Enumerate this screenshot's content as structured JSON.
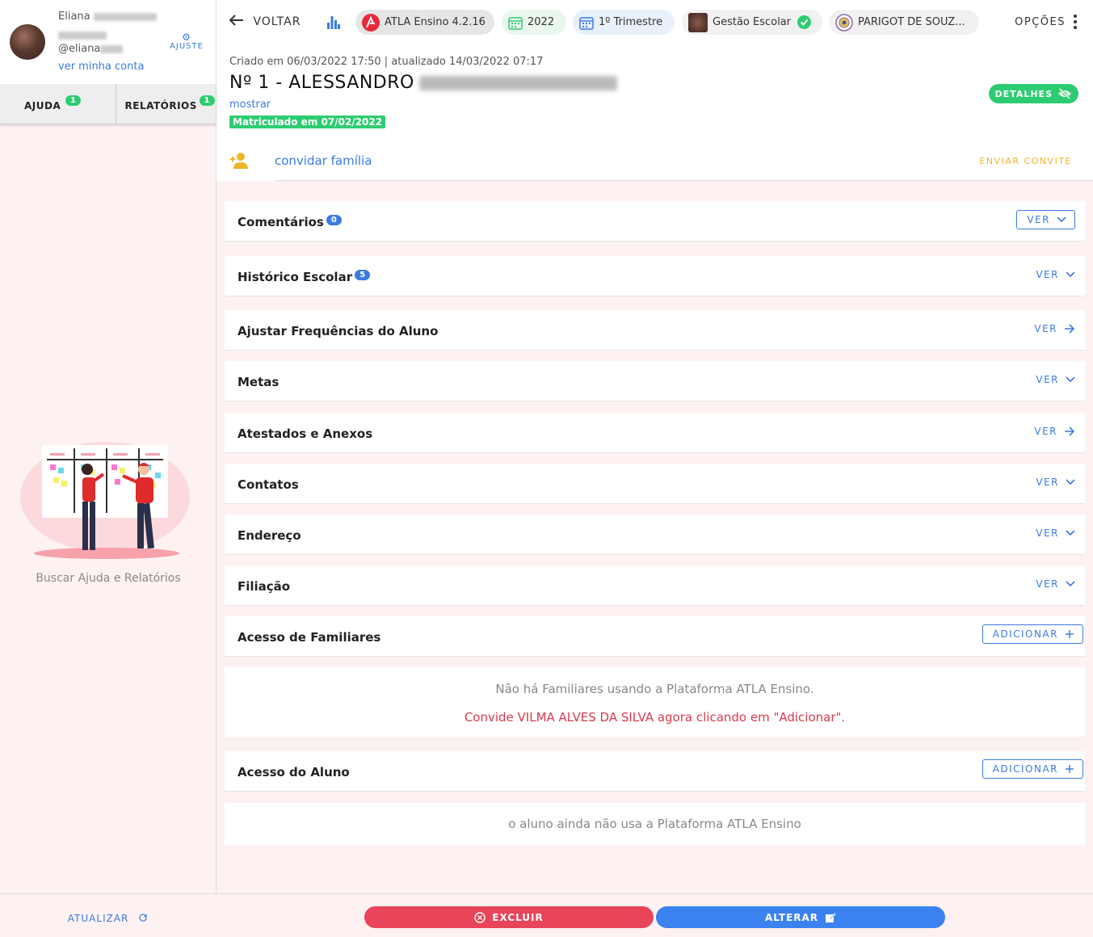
{
  "profile": {
    "first_name": "Eliana",
    "handle": "@eliana",
    "account_link": "ver minha conta",
    "settings_label": "AJUSTE"
  },
  "sidebar": {
    "tabs": [
      {
        "label": "AJUDA",
        "badge": "1"
      },
      {
        "label": "RELATÓRIOS",
        "badge": "1"
      }
    ],
    "help_text": "Buscar Ajuda e Relatórios",
    "refresh_label": "ATUALIZAR"
  },
  "topbar": {
    "back_label": "VOLTAR",
    "chips": {
      "app": "ATLA Ensino 4.2.16",
      "year": "2022",
      "period": "1º Trimestre",
      "module": "Gestão Escolar",
      "school": "PARIGOT DE SOUZ..."
    },
    "options_label": "OPÇÕES"
  },
  "student": {
    "meta": "Criado em 06/03/2022 17:50 | atualizado 14/03/2022 07:17",
    "title": "Nº 1 - ALESSANDRO",
    "show_link": "mostrar",
    "enrollment": "Matriculado em 07/02/2022",
    "details_label": "DETALHES"
  },
  "invite": {
    "link": "convidar família",
    "action": "ENVIAR CONVITE"
  },
  "sections": [
    {
      "title": "Comentários",
      "badge": "0",
      "action": "VER",
      "icon": "chevron-down-icon"
    },
    {
      "title": "Histórico Escolar",
      "badge": "5",
      "action": "VER",
      "icon": "chevron-down-icon"
    },
    {
      "title": "Ajustar Frequências do Aluno",
      "action": "VER",
      "icon": "arrow-right-icon"
    },
    {
      "title": "Metas",
      "action": "VER",
      "icon": "chevron-down-icon"
    },
    {
      "title": "Atestados e Anexos",
      "action": "VER",
      "icon": "arrow-right-icon"
    },
    {
      "title": "Contatos",
      "action": "VER",
      "icon": "chevron-down-icon"
    },
    {
      "title": "Endereço",
      "action": "VER",
      "icon": "chevron-down-icon"
    },
    {
      "title": "Filiação",
      "action": "VER",
      "icon": "chevron-down-icon"
    }
  ],
  "family_access": {
    "title": "Acesso de Familiares",
    "action": "ADICIONAR",
    "empty_line1": "Não há Familiares usando a Plataforma ATLA Ensino.",
    "empty_line2": "Convide VILMA ALVES DA SILVA agora clicando em \"Adicionar\"."
  },
  "student_access": {
    "title": "Acesso do Aluno",
    "action": "ADICIONAR",
    "empty_line": "o aluno ainda não usa a Plataforma ATLA Ensino"
  },
  "footer": {
    "delete_label": "EXCLUIR",
    "edit_label": "ALTERAR"
  },
  "colors": {
    "accent_blue": "#3b7be0",
    "success_green": "#2ecc71",
    "danger_red": "#e8445a",
    "warning_yellow": "#f0b429",
    "sidebar_bg": "#fdf1f1"
  }
}
